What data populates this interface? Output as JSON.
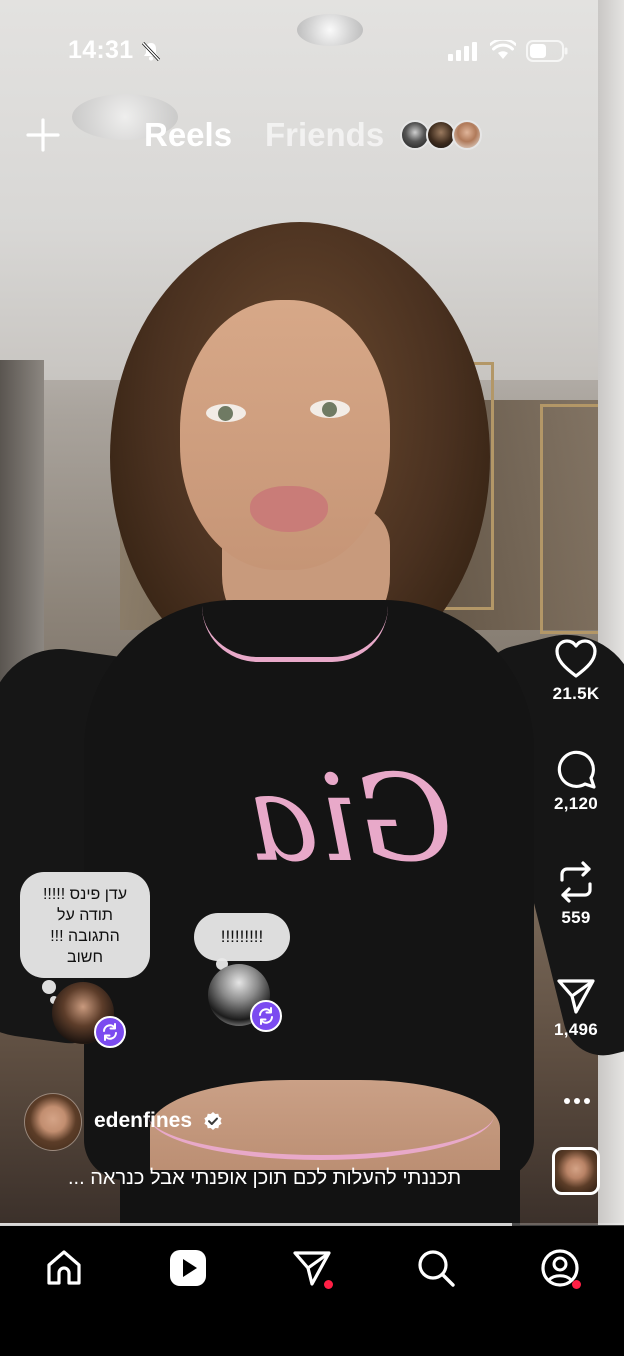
{
  "status_bar": {
    "time": "14:31"
  },
  "top_nav": {
    "tabs": [
      {
        "label": "Reels",
        "active": true
      },
      {
        "label": "Friends",
        "active": false
      }
    ]
  },
  "actions": {
    "likes": "21.5K",
    "comments": "2,120",
    "reposts": "559",
    "shares": "1,496"
  },
  "comment_bubbles": [
    {
      "text_lines": [
        "עדן פינס !!!!!",
        "תודה על",
        "התגובה !!!",
        "חשוב"
      ]
    },
    {
      "text": "!!!!!!!!!"
    }
  ],
  "post": {
    "username": "edenfines",
    "verified": true,
    "caption": "תכננתי להעלות לכם תוכן אופנתי אבל כנראה ...",
    "shirt_text": "Gia"
  },
  "playback_progress": 0.82,
  "bottom_nav": {
    "items": [
      {
        "name": "home",
        "active": false,
        "notification": false
      },
      {
        "name": "reels",
        "active": true,
        "notification": false
      },
      {
        "name": "messages",
        "active": false,
        "notification": true
      },
      {
        "name": "search",
        "active": false,
        "notification": false
      },
      {
        "name": "profile",
        "active": false,
        "notification": true
      }
    ]
  },
  "colors": {
    "accent_purple": "#7b4bf0",
    "notification_red": "#ff1f45",
    "shirt_pink": "#e8a9c9"
  }
}
